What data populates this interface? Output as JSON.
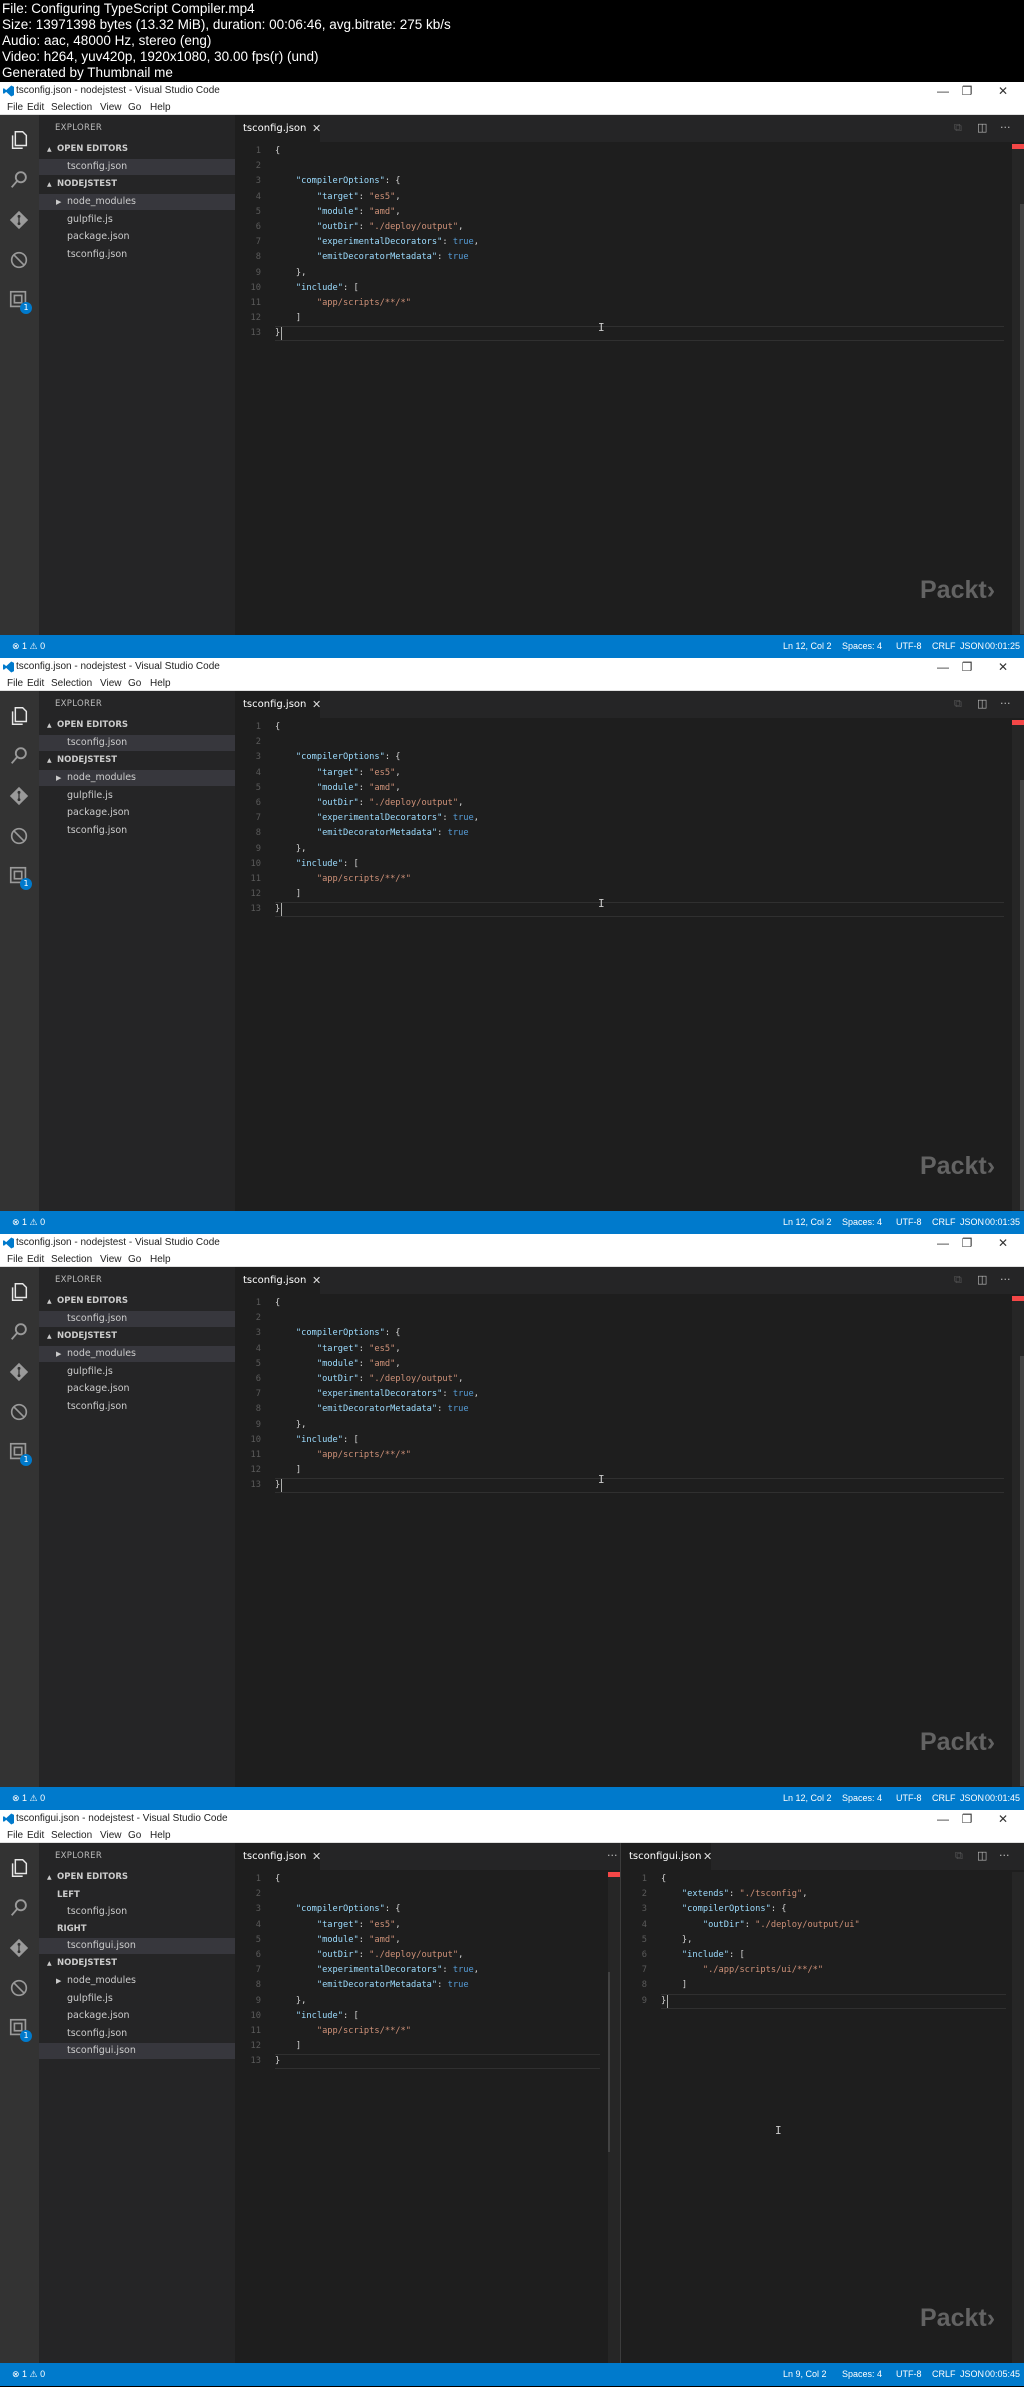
{
  "header": {
    "lines": [
      "File: Configuring TypeScript Compiler.mp4",
      "Size: 13971398 bytes (13.32 MiB), duration: 00:06:46, avg.bitrate: 275 kb/s",
      "Audio: aac, 48000 Hz, stereo (eng)",
      "Video: h264, yuv420p, 1920x1080, 30.00 fps(r) (und)",
      "Generated by Thumbnail me"
    ]
  },
  "colors": {
    "accent": "#007acc",
    "editor_bg": "#1e1e1e",
    "sidebar_bg": "#252526",
    "activity_bg": "#333333"
  },
  "menu": [
    "File",
    "Edit",
    "Selection",
    "View",
    "Go",
    "Help"
  ],
  "window_controls": {
    "minimize": "—",
    "restore": "❐",
    "close": "✕"
  },
  "explorer_title": "EXPLORER",
  "frames": [
    {
      "window_title": "tsconfig.json - nodejstest - Visual Studio Code",
      "open_editors_label": "OPEN EDITORS",
      "open_editors": [
        "tsconfig.json"
      ],
      "folder_label": "NODEJSTEST",
      "tree": [
        "node_modules",
        "gulpfile.js",
        "package.json",
        "tsconfig.json"
      ],
      "left_tab": "tsconfig.json",
      "status": {
        "problems": "⊗ 1 ⚠ 0",
        "position": "Ln 12, Col 2",
        "spaces": "Spaces: 4",
        "encoding": "UTF-8",
        "eol": "CRLF",
        "lang": "JSON",
        "timestamp": "00:01:25"
      },
      "watermark": "Packt›"
    },
    {
      "window_title": "tsconfig.json - nodejstest - Visual Studio Code",
      "open_editors_label": "OPEN EDITORS",
      "open_editors": [
        "tsconfig.json"
      ],
      "folder_label": "NODEJSTEST",
      "tree": [
        "node_modules",
        "gulpfile.js",
        "package.json",
        "tsconfig.json"
      ],
      "left_tab": "tsconfig.json",
      "status": {
        "problems": "⊗ 1 ⚠ 0",
        "position": "Ln 12, Col 2",
        "spaces": "Spaces: 4",
        "encoding": "UTF-8",
        "eol": "CRLF",
        "lang": "JSON",
        "timestamp": "00:01:35"
      },
      "watermark": "Packt›"
    },
    {
      "window_title": "tsconfig.json - nodejstest - Visual Studio Code",
      "open_editors_label": "OPEN EDITORS",
      "open_editors": [
        "tsconfig.json"
      ],
      "folder_label": "NODEJSTEST",
      "tree": [
        "node_modules",
        "gulpfile.js",
        "package.json",
        "tsconfig.json"
      ],
      "left_tab": "tsconfig.json",
      "status": {
        "problems": "⊗ 1 ⚠ 0",
        "position": "Ln 12, Col 2",
        "spaces": "Spaces: 4",
        "encoding": "UTF-8",
        "eol": "CRLF",
        "lang": "JSON",
        "timestamp": "00:01:45"
      },
      "watermark": "Packt›"
    },
    {
      "window_title": "tsconfigui.json - nodejstest - Visual Studio Code",
      "open_editors_label": "OPEN EDITORS",
      "groups": [
        {
          "label": "LEFT",
          "files": [
            "tsconfig.json"
          ]
        },
        {
          "label": "RIGHT",
          "files": [
            "tsconfigui.json"
          ]
        }
      ],
      "folder_label": "NODEJSTEST",
      "tree": [
        "node_modules",
        "gulpfile.js",
        "package.json",
        "tsconfig.json",
        "tsconfigui.json"
      ],
      "left_tab": "tsconfig.json",
      "right_tab": "tsconfigui.json",
      "status": {
        "problems": "⊗ 1 ⚠ 0",
        "position": "Ln 9, Col 2",
        "spaces": "Spaces: 4",
        "encoding": "UTF-8",
        "eol": "CRLF",
        "lang": "JSON",
        "timestamp": "00:05:45"
      },
      "watermark": "Packt›"
    }
  ],
  "tsconfig_code": [
    [
      [
        "p",
        "{"
      ]
    ],
    [
      [
        "p",
        ""
      ]
    ],
    [
      [
        "p",
        "    "
      ],
      [
        "k",
        "\"compilerOptions\""
      ],
      [
        "p",
        ": {"
      ]
    ],
    [
      [
        "p",
        "        "
      ],
      [
        "k",
        "\"target\""
      ],
      [
        "p",
        ": "
      ],
      [
        "s",
        "\"es5\""
      ],
      [
        "p",
        ","
      ]
    ],
    [
      [
        "p",
        "        "
      ],
      [
        "k",
        "\"module\""
      ],
      [
        "p",
        ": "
      ],
      [
        "s",
        "\"amd\""
      ],
      [
        "p",
        ","
      ]
    ],
    [
      [
        "p",
        "        "
      ],
      [
        "k",
        "\"outDir\""
      ],
      [
        "p",
        ": "
      ],
      [
        "s",
        "\"./deploy/output\""
      ],
      [
        "p",
        ","
      ]
    ],
    [
      [
        "p",
        "        "
      ],
      [
        "k",
        "\"experimentalDecorators\""
      ],
      [
        "p",
        ": "
      ],
      [
        "b",
        "true"
      ],
      [
        "p",
        ","
      ]
    ],
    [
      [
        "p",
        "        "
      ],
      [
        "k",
        "\"emitDecoratorMetadata\""
      ],
      [
        "p",
        ": "
      ],
      [
        "b",
        "true"
      ]
    ],
    [
      [
        "p",
        "    },"
      ]
    ],
    [
      [
        "p",
        "    "
      ],
      [
        "k",
        "\"include\""
      ],
      [
        "p",
        ": ["
      ]
    ],
    [
      [
        "p",
        "        "
      ],
      [
        "s",
        "\"app/scripts/**/*\""
      ]
    ],
    [
      [
        "p",
        "    ]"
      ]
    ],
    [
      [
        "p",
        "}"
      ]
    ]
  ],
  "tsconfigui_code": [
    [
      [
        "p",
        "{"
      ]
    ],
    [
      [
        "p",
        "    "
      ],
      [
        "k",
        "\"extends\""
      ],
      [
        "p",
        ": "
      ],
      [
        "s",
        "\"./tsconfig\""
      ],
      [
        "p",
        ","
      ]
    ],
    [
      [
        "p",
        "    "
      ],
      [
        "k",
        "\"compilerOptions\""
      ],
      [
        "p",
        ": {"
      ]
    ],
    [
      [
        "p",
        "        "
      ],
      [
        "k",
        "\"outDir\""
      ],
      [
        "p",
        ": "
      ],
      [
        "s",
        "\"./deploy/output/ui\""
      ]
    ],
    [
      [
        "p",
        "    },"
      ]
    ],
    [
      [
        "p",
        "    "
      ],
      [
        "k",
        "\"include\""
      ],
      [
        "p",
        ": ["
      ]
    ],
    [
      [
        "p",
        "        "
      ],
      [
        "s",
        "\"./app/scripts/ui/**/*\""
      ]
    ],
    [
      [
        "p",
        "    ]"
      ]
    ],
    [
      [
        "p",
        "}"
      ]
    ]
  ]
}
